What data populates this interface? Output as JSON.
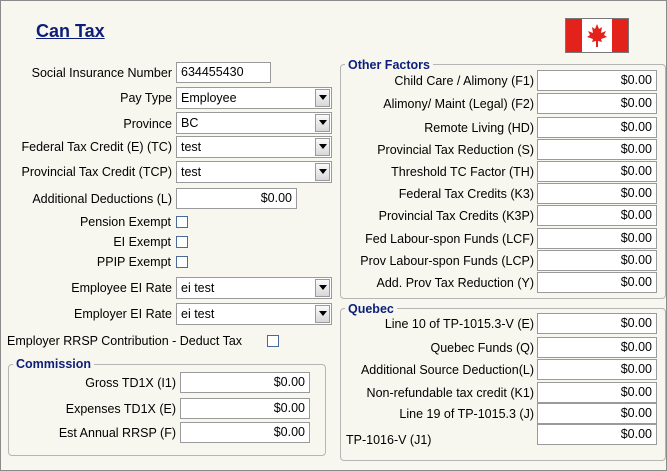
{
  "title": "Can Tax",
  "flag": {
    "name": "canada-flag",
    "red": "#e3221c"
  },
  "left": {
    "sin_label": "Social Insurance Number",
    "sin_value": "634455430",
    "pay_type_label": "Pay Type",
    "pay_type_value": "Employee",
    "province_label": "Province",
    "province_value": "BC",
    "fed_credit_label": "Federal Tax Credit (E) (TC)",
    "fed_credit_value": "test",
    "prov_credit_label": "Provincial Tax Credit (TCP)",
    "prov_credit_value": "test",
    "add_ded_label": "Additional Deductions (L)",
    "add_ded_value": "$0.00",
    "pension_label": "Pension Exempt",
    "ei_label": "EI Exempt",
    "ppip_label": "PPIP Exempt",
    "emp_ei_label": "Employee EI Rate",
    "emp_ei_value": "ei test",
    "er_ei_label": "Employer EI Rate",
    "er_ei_value": "ei test",
    "rrsp_label": "Employer RRSP Contribution - Deduct Tax"
  },
  "commission": {
    "title": "Commission",
    "rows": [
      {
        "label": "Gross TD1X  (I1)",
        "value": "$0.00"
      },
      {
        "label": "Expenses TD1X  (E)",
        "value": "$0.00"
      },
      {
        "label": "Est Annual RRSP  (F)",
        "value": "$0.00"
      }
    ]
  },
  "other": {
    "title": "Other Factors",
    "rows": [
      {
        "label": "Child Care / Alimony (F1)",
        "value": "$0.00"
      },
      {
        "label": "Alimony/ Maint (Legal) (F2)",
        "value": "$0.00"
      },
      {
        "label": "Remote Living (HD)",
        "value": "$0.00"
      },
      {
        "label": "Provincial Tax Reduction (S)",
        "value": "$0.00"
      },
      {
        "label": "Threshold TC Factor (TH)",
        "value": "$0.00"
      },
      {
        "label": "Federal Tax Credits (K3)",
        "value": "$0.00"
      },
      {
        "label": "Provincial Tax Credits (K3P)",
        "value": "$0.00"
      },
      {
        "label": "Fed Labour-spon Funds (LCF)",
        "value": "$0.00"
      },
      {
        "label": "Prov Labour-spon Funds (LCP)",
        "value": "$0.00"
      },
      {
        "label": "Add. Prov Tax Reduction (Y)",
        "value": "$0.00"
      }
    ]
  },
  "quebec": {
    "title": "Quebec",
    "rows": [
      {
        "label": "Line 10 of TP-1015.3-V  (E)",
        "value": "$0.00"
      },
      {
        "label": "Quebec Funds  (Q)",
        "value": "$0.00"
      },
      {
        "label": "Additional Source Deduction(L)",
        "value": "$0.00"
      },
      {
        "label": "Non-refundable tax credit (K1)",
        "value": "$0.00"
      },
      {
        "label": "Line 19 of TP-1015.3  (J)",
        "value": "$0.00"
      },
      {
        "label": "TP-1016-V  (J1)",
        "value": "$0.00"
      }
    ]
  }
}
